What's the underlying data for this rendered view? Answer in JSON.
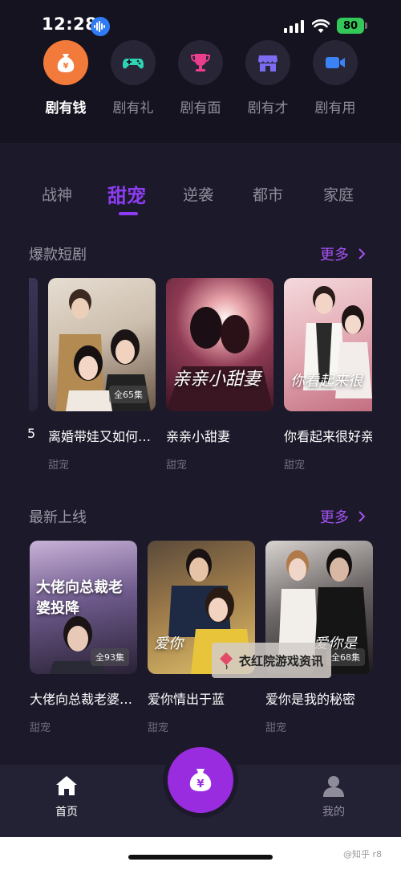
{
  "status_bar": {
    "time": "12:28",
    "battery": "80"
  },
  "quick_nav": [
    {
      "label": "剧有钱",
      "icon": "money-bag-icon",
      "active": true
    },
    {
      "label": "剧有礼",
      "icon": "gamepad-icon",
      "active": false
    },
    {
      "label": "剧有面",
      "icon": "trophy-icon",
      "active": false
    },
    {
      "label": "剧有才",
      "icon": "shop-icon",
      "active": false
    },
    {
      "label": "剧有用",
      "icon": "video-camera-icon",
      "active": false
    }
  ],
  "tabs": [
    "战神",
    "甜宠",
    "逆袭",
    "都市",
    "家庭"
  ],
  "active_tab": "甜宠",
  "sections": {
    "hot": {
      "title": "爆款短剧",
      "more": "更多",
      "items": [
        {
          "title": "离婚带娃又如何…",
          "genre": "甜宠",
          "badge": "全65集"
        },
        {
          "title": "亲亲小甜妻",
          "genre": "甜宠",
          "poster_text": "亲亲小甜妻"
        },
        {
          "title": "你看起来很好亲",
          "genre": "甜宠",
          "poster_text": "你看起来很"
        }
      ]
    },
    "new": {
      "title": "最新上线",
      "more": "更多",
      "items": [
        {
          "title": "大佬向总裁老婆…",
          "genre": "甜宠",
          "badge": "全93集",
          "poster_text": "大佬向总裁老婆投降"
        },
        {
          "title": "爱你情出于蓝",
          "genre": "甜宠",
          "poster_text": "爱你"
        },
        {
          "title": "爱你是我的秘密",
          "genre": "甜宠",
          "badge": "全68集",
          "poster_text": "爱你是"
        }
      ]
    }
  },
  "watermark": "衣红院游戏资讯",
  "bottom_nav": {
    "home": "首页",
    "mine": "我的"
  },
  "credit": "@知乎 r8",
  "colors": {
    "accent": "#8c3cf2",
    "orange": "#f27a3a",
    "more": "#a552f2"
  }
}
